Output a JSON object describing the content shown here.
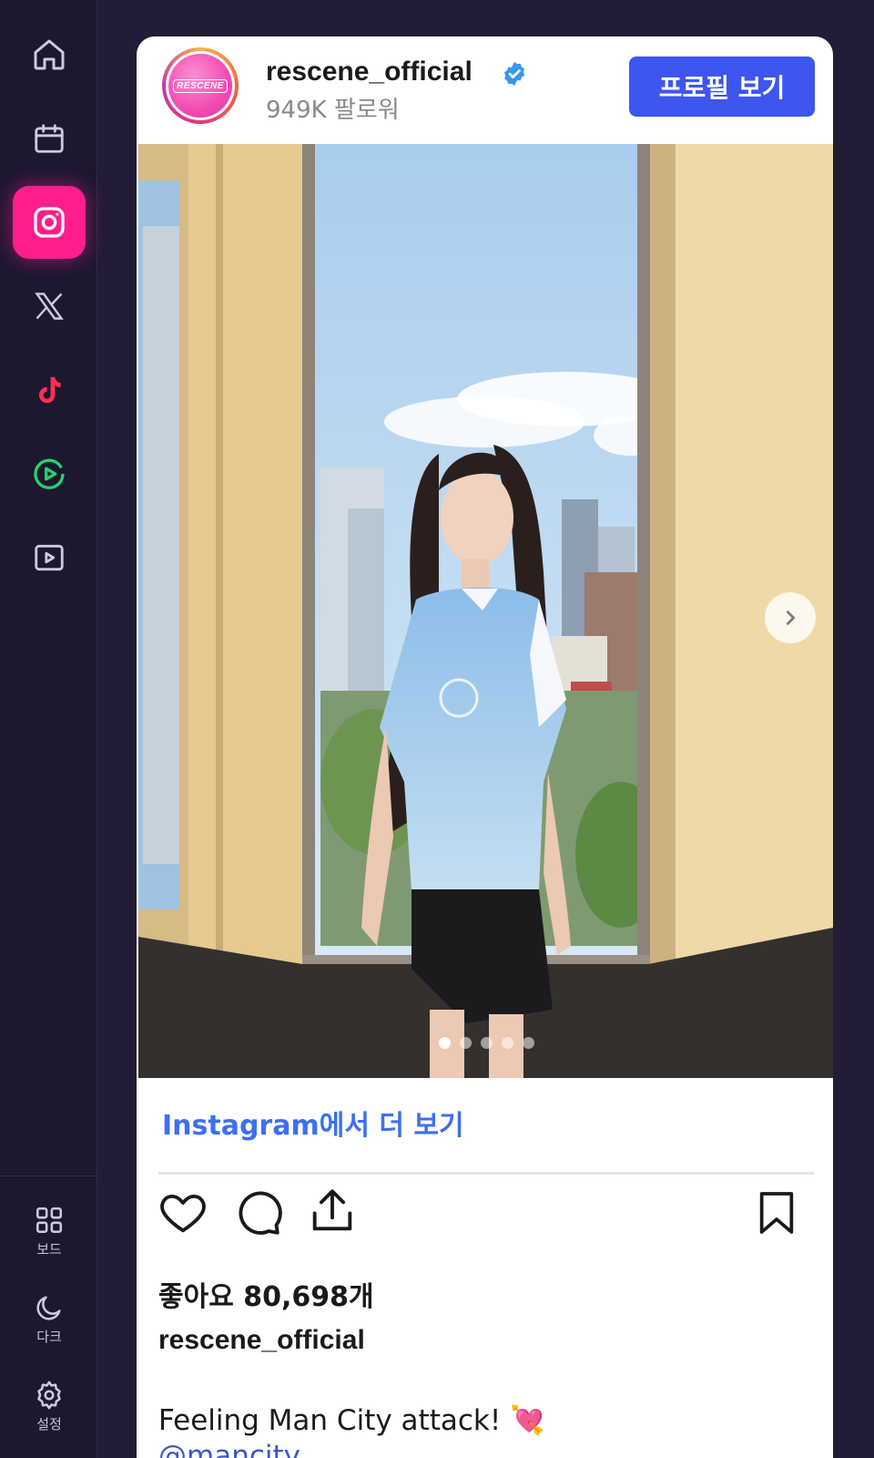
{
  "sidebar": {
    "items": [
      {
        "icon": "home-icon"
      },
      {
        "icon": "calendar-icon"
      },
      {
        "icon": "instagram-icon",
        "active": true
      },
      {
        "icon": "x-twitter-icon"
      },
      {
        "icon": "tiktok-icon"
      },
      {
        "icon": "play-circle-icon"
      },
      {
        "icon": "video-player-icon"
      }
    ],
    "bottom": [
      {
        "icon": "grid-icon",
        "label": "보드"
      },
      {
        "icon": "moon-icon",
        "label": "다크"
      },
      {
        "icon": "gear-icon",
        "label": "설정"
      }
    ],
    "accent_color": "#ff1e8c"
  },
  "post": {
    "username": "rescene_official",
    "followers": "949K 팔로워",
    "profile_button": "프로필 보기",
    "more_link": "Instagram에서 더 보기",
    "likes": "좋아요 80,698개",
    "caption_username": "rescene_official",
    "caption": "Feeling Man City attack! 💘",
    "mention": "@mancity",
    "carousel": {
      "total": 5,
      "current": 1
    },
    "accent_color": "#3e56f0"
  }
}
